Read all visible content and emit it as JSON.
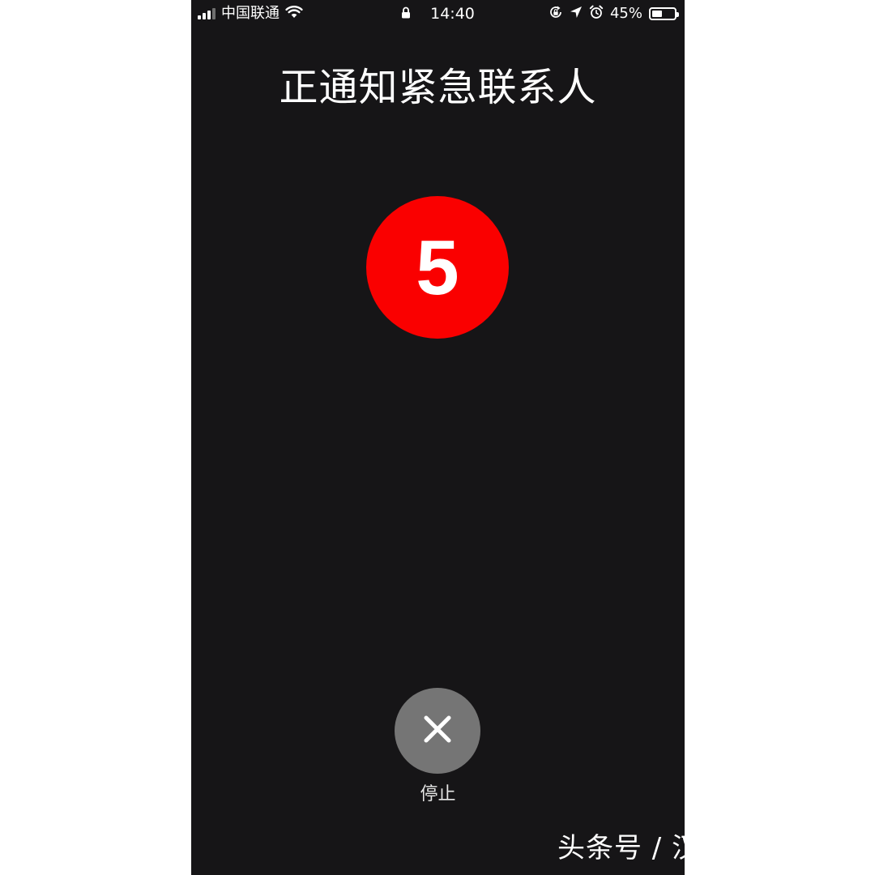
{
  "status_bar": {
    "carrier": "中国联通",
    "time": "14:40",
    "battery_percent": "45%",
    "battery_level": 0.45,
    "signal_bars_active": 3,
    "signal_bars_total": 4,
    "icons": [
      "signal-icon",
      "wifi-icon",
      "lock-icon",
      "rotation-lock-icon",
      "location-icon",
      "alarm-icon",
      "battery-icon"
    ]
  },
  "screen": {
    "title": "正通知紧急联系人",
    "countdown": "5",
    "countdown_color": "#fa0000",
    "stop_label": "停止",
    "stop_icon": "close-icon",
    "background_color": "#161517"
  },
  "watermark": {
    "text": "头条号 / 汉圈老油条"
  }
}
